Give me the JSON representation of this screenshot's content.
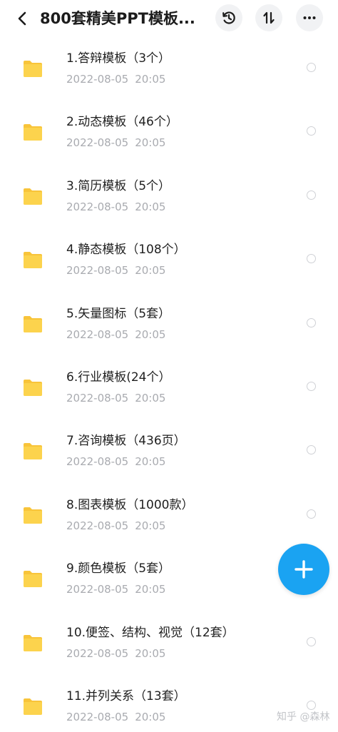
{
  "header": {
    "title": "800套精美PPT模板...",
    "back_icon": "back-arrow-icon",
    "history_icon": "history-clock-icon",
    "sort_icon": "sort-arrows-icon",
    "more_icon": "more-dots-icon"
  },
  "files": [
    {
      "name": "1.答辩模板（3个）",
      "date": "2022-08-05",
      "time": "20:05"
    },
    {
      "name": "2.动态模板（46个）",
      "date": "2022-08-05",
      "time": "20:05"
    },
    {
      "name": "3.简历模板（5个）",
      "date": "2022-08-05",
      "time": "20:05"
    },
    {
      "name": "4.静态模板（108个）",
      "date": "2022-08-05",
      "time": "20:05"
    },
    {
      "name": "5.矢量图标（5套）",
      "date": "2022-08-05",
      "time": "20:05"
    },
    {
      "name": "6.行业模板(24个）",
      "date": "2022-08-05",
      "time": "20:05"
    },
    {
      "name": "7.咨询模板（436页）",
      "date": "2022-08-05",
      "time": "20:05"
    },
    {
      "name": "8.图表模板（1000款）",
      "date": "2022-08-05",
      "time": "20:05"
    },
    {
      "name": "9.颜色模板（5套）",
      "date": "2022-08-05",
      "time": "20:05"
    },
    {
      "name": "10.便签、结构、视觉（12套）",
      "date": "2022-08-05",
      "time": "20:05"
    },
    {
      "name": "11.并列关系（13套）",
      "date": "2022-08-05",
      "time": "20:05"
    }
  ],
  "fab": {
    "icon": "plus-icon"
  },
  "watermark": "知乎 @森林",
  "colors": {
    "folder": "#fcd34d",
    "folder_tab": "#f8c43a",
    "fab": "#1aa3f2",
    "meta_text": "#a9abb0"
  }
}
